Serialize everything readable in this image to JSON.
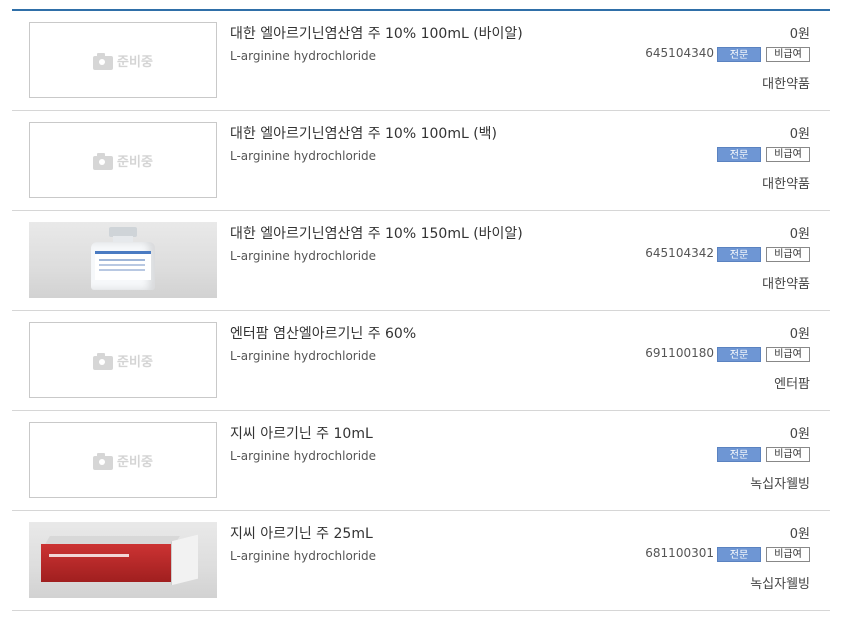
{
  "products": [
    {
      "title": "대한 엘아르기닌염산염 주 10% 100mL (바이알)",
      "ingredient": "L-arginine hydrochloride",
      "price": "0원",
      "code": "645104340",
      "badge_pro": "전문",
      "badge_cov": "비급여",
      "maker": "대한약품",
      "image": "placeholder",
      "placeholder_text": "준비중"
    },
    {
      "title": "대한 엘아르기닌염산염 주 10% 100mL (백)",
      "ingredient": "L-arginine hydrochloride",
      "price": "0원",
      "code": "",
      "badge_pro": "전문",
      "badge_cov": "비급여",
      "maker": "대한약품",
      "image": "placeholder",
      "placeholder_text": "준비중"
    },
    {
      "title": "대한 엘아르기닌염산염 주 10% 150mL (바이알)",
      "ingredient": "L-arginine hydrochloride",
      "price": "0원",
      "code": "645104342",
      "badge_pro": "전문",
      "badge_cov": "비급여",
      "maker": "대한약품",
      "image": "vial-photo",
      "placeholder_text": ""
    },
    {
      "title": "엔터팜 염산엘아르기닌 주 60%",
      "ingredient": "L-arginine hydrochloride",
      "price": "0원",
      "code": "691100180",
      "badge_pro": "전문",
      "badge_cov": "비급여",
      "maker": "엔터팜",
      "image": "placeholder",
      "placeholder_text": "준비중"
    },
    {
      "title": "지씨 아르기닌 주 10mL",
      "ingredient": "L-arginine hydrochloride",
      "price": "0원",
      "code": "",
      "badge_pro": "전문",
      "badge_cov": "비급여",
      "maker": "녹십자웰빙",
      "image": "placeholder",
      "placeholder_text": "준비중"
    },
    {
      "title": "지씨 아르기닌 주 25mL",
      "ingredient": "L-arginine hydrochloride",
      "price": "0원",
      "code": "681100301",
      "badge_pro": "전문",
      "badge_cov": "비급여",
      "maker": "녹십자웰빙",
      "image": "box-photo",
      "placeholder_text": ""
    }
  ],
  "colors": {
    "accent_rule": "#2f6fa8",
    "badge_pro_bg": "#6e96d4"
  }
}
